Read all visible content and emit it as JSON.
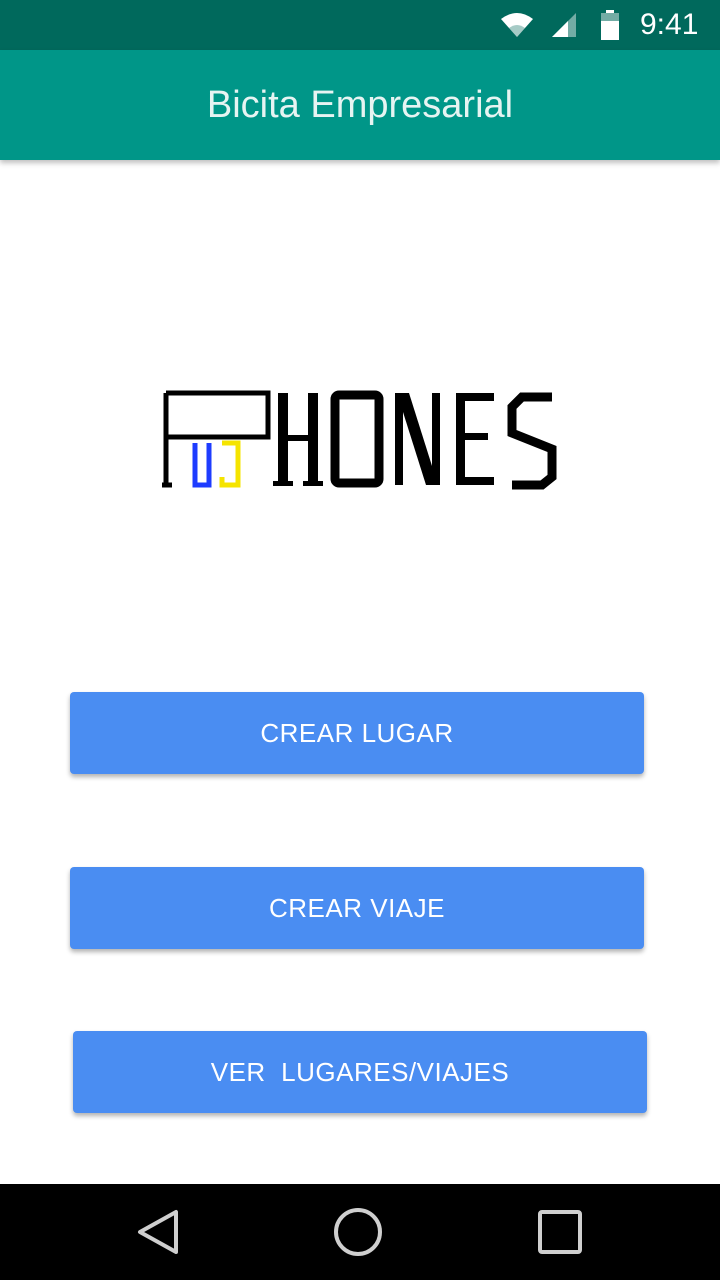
{
  "status_bar": {
    "time": "9:41",
    "icons": [
      "wifi-icon",
      "signal-icon",
      "battery-icon"
    ]
  },
  "app_bar": {
    "title": "Bicita Empresarial"
  },
  "logo": {
    "text": "PHONES",
    "letters": "UJ",
    "colors": {
      "main": "#000000",
      "u": "#1e3cff",
      "j": "#f5e400"
    }
  },
  "buttons": {
    "crear_lugar": "CREAR LUGAR",
    "crear_viaje": "CREAR VIAJE",
    "ver_lugares_viajes": "VER  LUGARES/VIAJES"
  },
  "nav_bar": {
    "icons": [
      "back-icon",
      "home-icon",
      "recents-icon"
    ]
  },
  "colors": {
    "status_bar": "#00695c",
    "app_bar": "#009688",
    "button": "#4a8df2",
    "nav_bar": "#000000"
  }
}
